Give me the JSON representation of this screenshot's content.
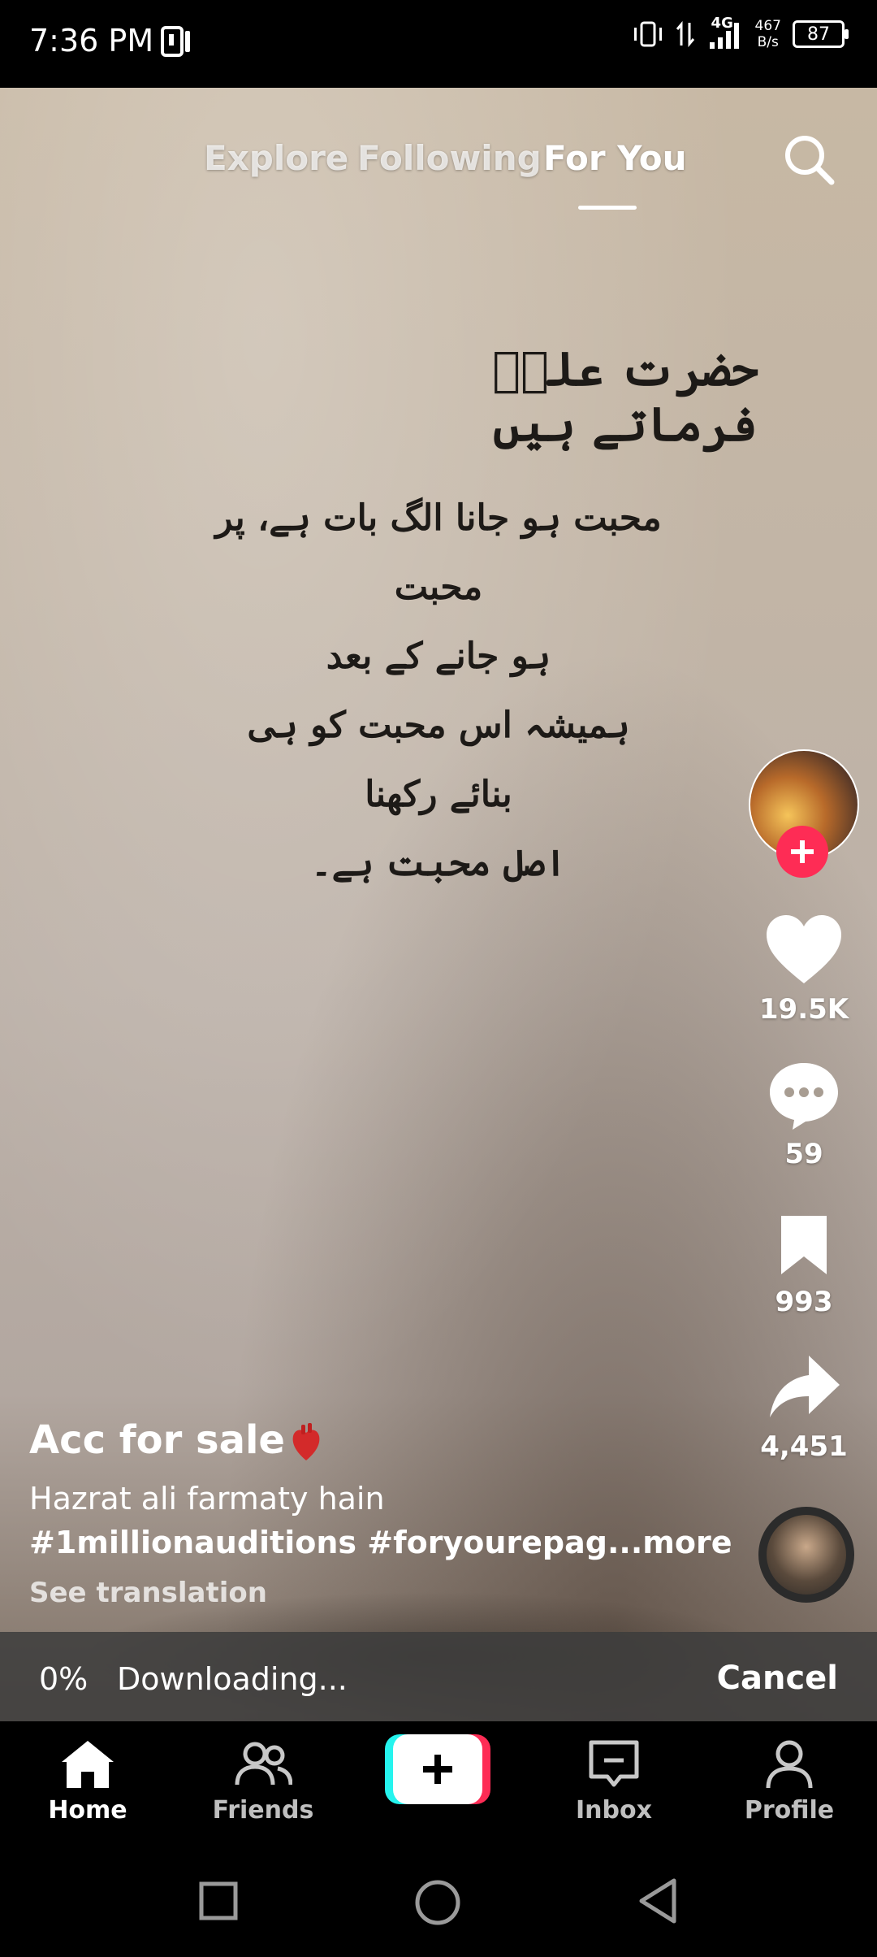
{
  "status_bar": {
    "time": "7:36 PM",
    "net_speed_value": "467",
    "net_speed_unit": "B/s",
    "signal_type": "4G",
    "battery": "87"
  },
  "top_tabs": {
    "explore": "Explore",
    "following": "Following",
    "for_you": "For You",
    "active": "For You"
  },
  "video_text": {
    "title": "حضرت علیؓ فرماتے ہیں",
    "lines": [
      "محبت ہو جانا الگ بات ہے، پر محبت",
      "ہو جانے کے بعد",
      "ہمیشہ اس محبت کو ہی بنائے رکھنا",
      "اصل محبت ہے۔"
    ]
  },
  "actions": {
    "likes": "19.5K",
    "comments": "59",
    "saves": "993",
    "shares": "4,451"
  },
  "caption": {
    "username": "Acc for sale",
    "description": "Hazrat ali farmaty hain",
    "hashtags": "#1millionauditions #foryourepag...",
    "more": "more",
    "see_translation": "See translation"
  },
  "download": {
    "percent": "0%",
    "status": "Downloading...",
    "cancel": "Cancel"
  },
  "bottom_nav": {
    "home": "Home",
    "friends": "Friends",
    "inbox": "Inbox",
    "profile": "Profile",
    "active": "Home"
  },
  "colors": {
    "accent_red": "#fe2c55",
    "accent_cyan": "#25f4ee"
  }
}
